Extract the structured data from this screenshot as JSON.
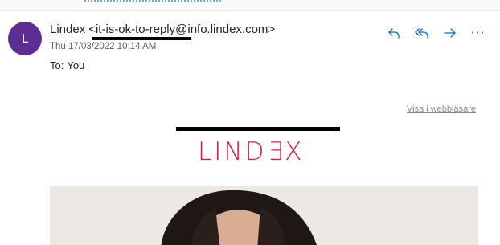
{
  "message": {
    "avatar_initial": "L",
    "sender_name": "Lindex",
    "sender_address": "<it-is-ok-to-reply@info.lindex.com>",
    "date": "Thu 17/03/2022 10:14 AM",
    "to_label": "To:",
    "to_name": "You"
  },
  "actions": {
    "reply_icon": "reply-icon",
    "reply_all_icon": "reply-all-icon",
    "forward_icon": "forward-icon",
    "more_label": "···",
    "accent_color": "#0f6cbd"
  },
  "body": {
    "browser_link": "Visa i webbläsare",
    "logo_part1": "LIND",
    "logo_part2": "E",
    "logo_part3": "X",
    "logo_color": "#cc1f48",
    "hero_image": "woman-portrait-photo"
  },
  "colors": {
    "avatar_bg": "#5c2e91"
  }
}
